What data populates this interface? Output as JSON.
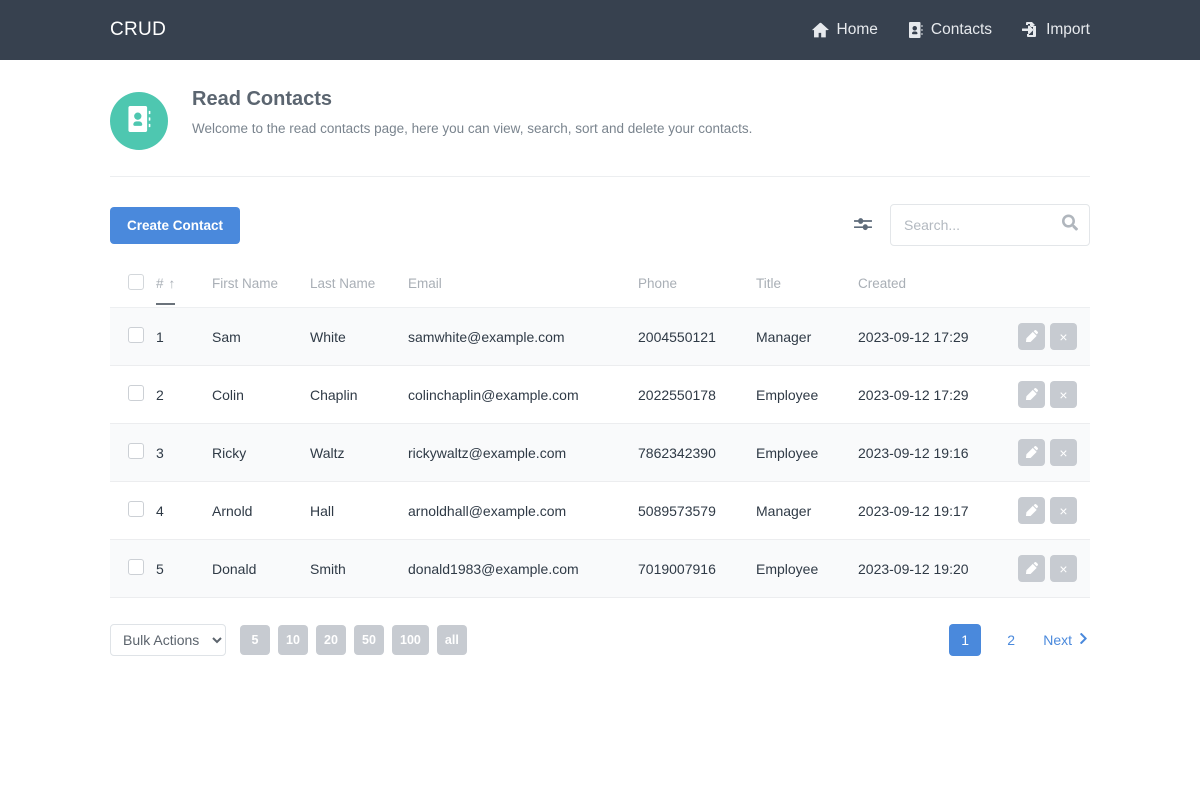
{
  "navbar": {
    "brand": "CRUD",
    "links": [
      {
        "label": "Home",
        "icon": "home-icon"
      },
      {
        "label": "Contacts",
        "icon": "address-book-icon"
      },
      {
        "label": "Import",
        "icon": "file-import-icon"
      }
    ]
  },
  "header": {
    "icon": "address-book-icon",
    "title": "Read Contacts",
    "subtitle": "Welcome to the read contacts page, here you can view, search, sort and delete your contacts.",
    "accent_color": "#4ec7b0"
  },
  "toolbar": {
    "create_label": "Create Contact",
    "create_color": "#4a89dc",
    "filter_icon": "sliders-icon",
    "search": {
      "placeholder": "Search...",
      "value": "",
      "icon": "search-icon"
    }
  },
  "table": {
    "columns": [
      {
        "key": "check",
        "label": ""
      },
      {
        "key": "id",
        "label": "#",
        "sorted": true,
        "sort_dir": "↑"
      },
      {
        "key": "first",
        "label": "First Name"
      },
      {
        "key": "last",
        "label": "Last Name"
      },
      {
        "key": "email",
        "label": "Email"
      },
      {
        "key": "phone",
        "label": "Phone"
      },
      {
        "key": "title",
        "label": "Title"
      },
      {
        "key": "created",
        "label": "Created"
      },
      {
        "key": "actions",
        "label": ""
      }
    ],
    "rows": [
      {
        "id": "1",
        "first": "Sam",
        "last": "White",
        "email": "samwhite@example.com",
        "phone": "2004550121",
        "title": "Manager",
        "created": "2023-09-12 17:29"
      },
      {
        "id": "2",
        "first": "Colin",
        "last": "Chaplin",
        "email": "colinchaplin@example.com",
        "phone": "2022550178",
        "title": "Employee",
        "created": "2023-09-12 17:29"
      },
      {
        "id": "3",
        "first": "Ricky",
        "last": "Waltz",
        "email": "rickywaltz@example.com",
        "phone": "7862342390",
        "title": "Employee",
        "created": "2023-09-12 19:16"
      },
      {
        "id": "4",
        "first": "Arnold",
        "last": "Hall",
        "email": "arnoldhall@example.com",
        "phone": "5089573579",
        "title": "Manager",
        "created": "2023-09-12 19:17"
      },
      {
        "id": "5",
        "first": "Donald",
        "last": "Smith",
        "email": "donald1983@example.com",
        "phone": "7019007916",
        "title": "Employee",
        "created": "2023-09-12 19:20"
      }
    ],
    "row_actions": {
      "edit_icon": "pencil-icon",
      "delete_icon": "close-icon",
      "delete_glyph": "×"
    }
  },
  "footer": {
    "bulk_actions": {
      "selected": "Bulk Actions",
      "options": [
        "Bulk Actions"
      ]
    },
    "page_sizes": [
      "5",
      "10",
      "20",
      "50",
      "100",
      "all"
    ],
    "pagination": {
      "pages": [
        "1",
        "2"
      ],
      "active": "1",
      "next_label": "Next",
      "next_icon": "chevron-right-icon"
    }
  }
}
